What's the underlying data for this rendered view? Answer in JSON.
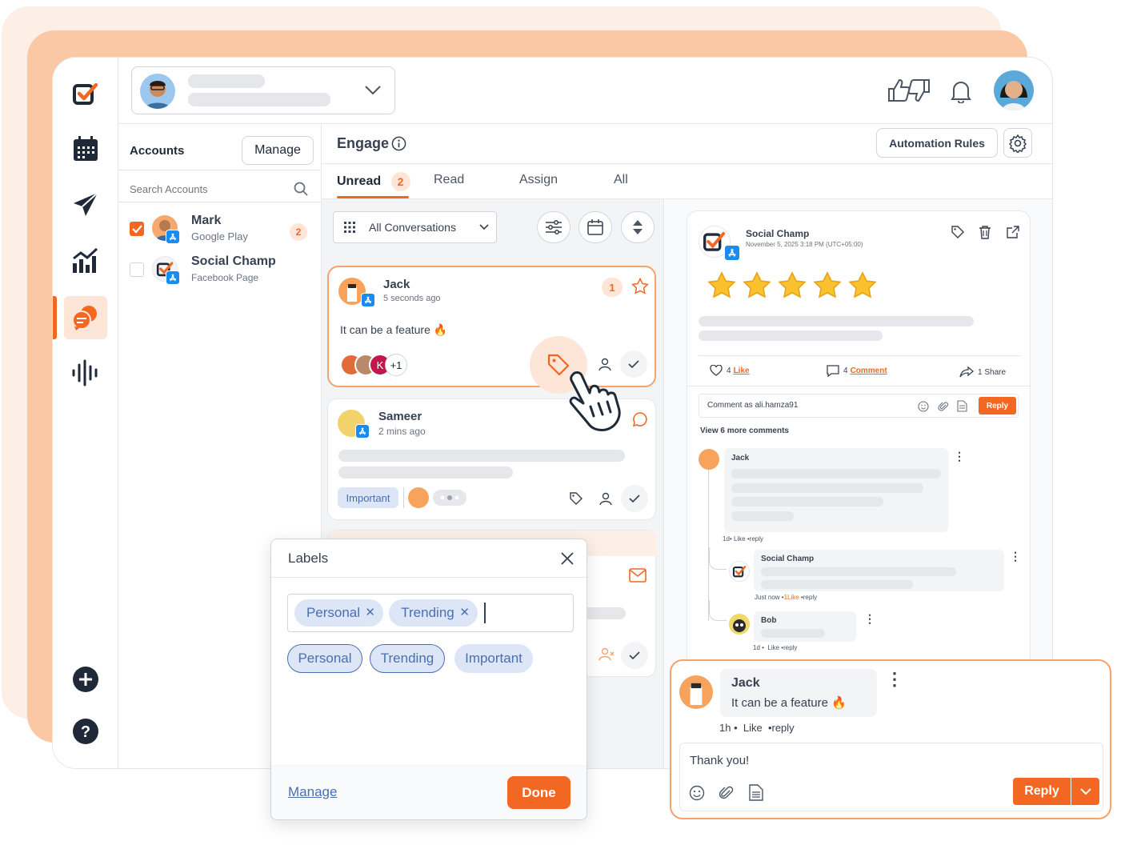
{
  "header": {
    "reactions_icon": "thumbs-up-down-icon",
    "bell_icon": "bell-icon"
  },
  "accounts": {
    "title": "Accounts",
    "manage_label": "Manage",
    "search_placeholder": "Search Accounts",
    "items": [
      {
        "name": "Mark",
        "platform": "Google Play",
        "count": "2",
        "checked": true
      },
      {
        "name": "Social Champ",
        "platform": "Facebook Page",
        "count": "",
        "checked": false
      }
    ]
  },
  "engage": {
    "title": "Engage",
    "automation_label": "Automation Rules",
    "tabs": [
      {
        "label": "Unread",
        "count": "2"
      },
      {
        "label": "Read"
      },
      {
        "label": "Assign"
      },
      {
        "label": "All"
      }
    ],
    "filter_label": "All Conversations"
  },
  "conversations": [
    {
      "name": "Jack",
      "time": "5 seconds ago",
      "count": "1",
      "message": "It can be a feature",
      "extra_assignees": "+1",
      "avatar_letter": "K"
    },
    {
      "name": "Sameer",
      "time": "2 mins ago",
      "label": "Important"
    }
  ],
  "post": {
    "author": "Social Champ",
    "date": "November 5, 2025 3:18 PM (UTC+05:00)",
    "rating": 5,
    "likes_count": "4",
    "likes_label": "Like",
    "comments_count": "4",
    "comments_label": "Comment",
    "shares_label": "1 Share",
    "comment_placeholder": "Comment as ali.hamza91",
    "reply_label": "Reply",
    "view_more": "View 6 more comments",
    "comments": [
      {
        "name": "Jack",
        "meta_time": "1d",
        "meta_like": "Like",
        "meta_reply": "reply"
      },
      {
        "name": "Social Champ",
        "meta_time": "Just now",
        "meta_like": "1Like",
        "meta_reply": "reply"
      },
      {
        "name": "Bob",
        "meta_time": "1d",
        "meta_like": "Like",
        "meta_reply": "reply"
      }
    ]
  },
  "labels_modal": {
    "title": "Labels",
    "selected": [
      "Personal",
      "Trending"
    ],
    "options": [
      "Personal",
      "Trending",
      "Important"
    ],
    "manage_label": "Manage",
    "done_label": "Done"
  },
  "reply_popup": {
    "name": "Jack",
    "message": "It can be a feature",
    "time": "1h",
    "like": "Like",
    "reply_link": "reply",
    "input_value": "Thank you!",
    "reply_label": "Reply"
  },
  "colors": {
    "accent": "#f26722",
    "label_blue": "#4a6fb0",
    "label_bg": "#dde6f7"
  }
}
